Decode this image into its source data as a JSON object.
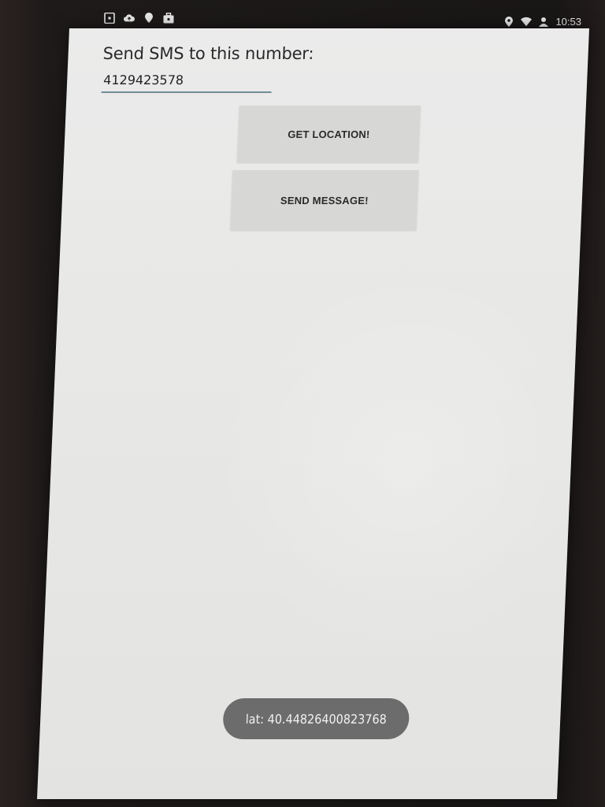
{
  "status_bar": {
    "left_icons": [
      "notification-icon",
      "cloud-upload-icon",
      "location-pin-icon",
      "briefcase-icon"
    ],
    "right_icons": [
      "location-pin-icon",
      "wifi-icon",
      "account-icon"
    ],
    "time": "10:53"
  },
  "form": {
    "label": "Send SMS to this number:",
    "phone_value": "4129423578"
  },
  "buttons": {
    "get_location": "GET LOCATION!",
    "send_message": "SEND MESSAGE!"
  },
  "toast": {
    "text": "lat: 40.44826400823768"
  }
}
